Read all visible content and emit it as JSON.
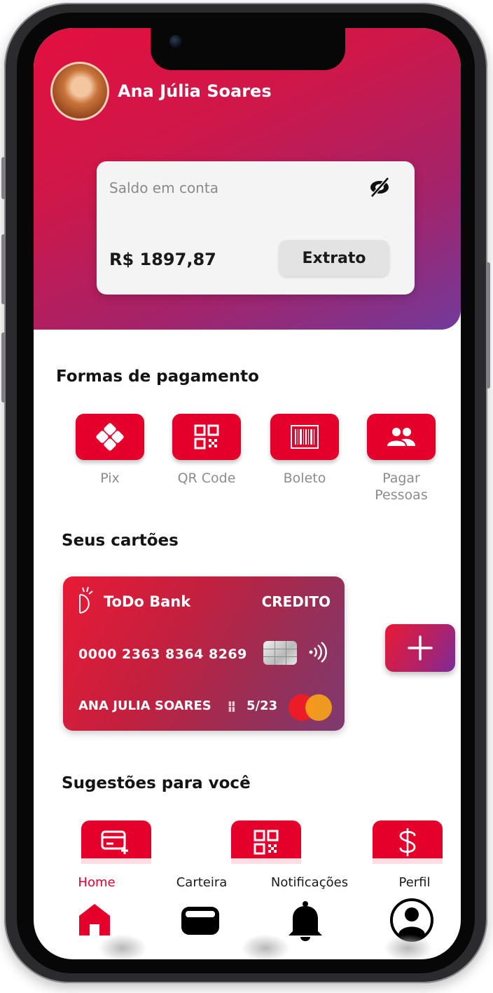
{
  "user": {
    "name": "Ana Júlia Soares"
  },
  "balance": {
    "label": "Saldo em conta",
    "value": "R$ 1897,87",
    "statement_button": "Extrato"
  },
  "payment_methods": {
    "title": "Formas de pagamento",
    "items": [
      {
        "label": "Pix",
        "icon": "pix-icon"
      },
      {
        "label": "QR Code",
        "icon": "qr-code-icon"
      },
      {
        "label": "Boleto",
        "icon": "barcode-icon"
      },
      {
        "label_line1": "Pagar",
        "label_line2": "Pessoas",
        "icon": "people-icon"
      }
    ]
  },
  "cards": {
    "title": "Seus cartões",
    "card": {
      "bank": "ToDo Bank",
      "type": "CREDITO",
      "number": "0000 2363 8364 8269",
      "holder": "ANA JULIA SOARES",
      "expiry": "5/23",
      "brand_icon": "mastercard-icon"
    }
  },
  "suggestions": {
    "title": "Sugestões para você",
    "items": [
      {
        "icon": "card-add-icon"
      },
      {
        "icon": "qr-code-icon"
      },
      {
        "icon": "dollar-icon"
      }
    ]
  },
  "nav": {
    "items": [
      {
        "label": "Home",
        "icon": "home-icon",
        "active": true
      },
      {
        "label": "Carteira",
        "icon": "wallet-icon"
      },
      {
        "label": "Notificações",
        "icon": "bell-icon"
      },
      {
        "label": "Perfil",
        "icon": "profile-icon"
      }
    ]
  },
  "colors": {
    "primary": "#e4002b",
    "gradient_start": "#e3103f",
    "gradient_end": "#723a9b"
  }
}
